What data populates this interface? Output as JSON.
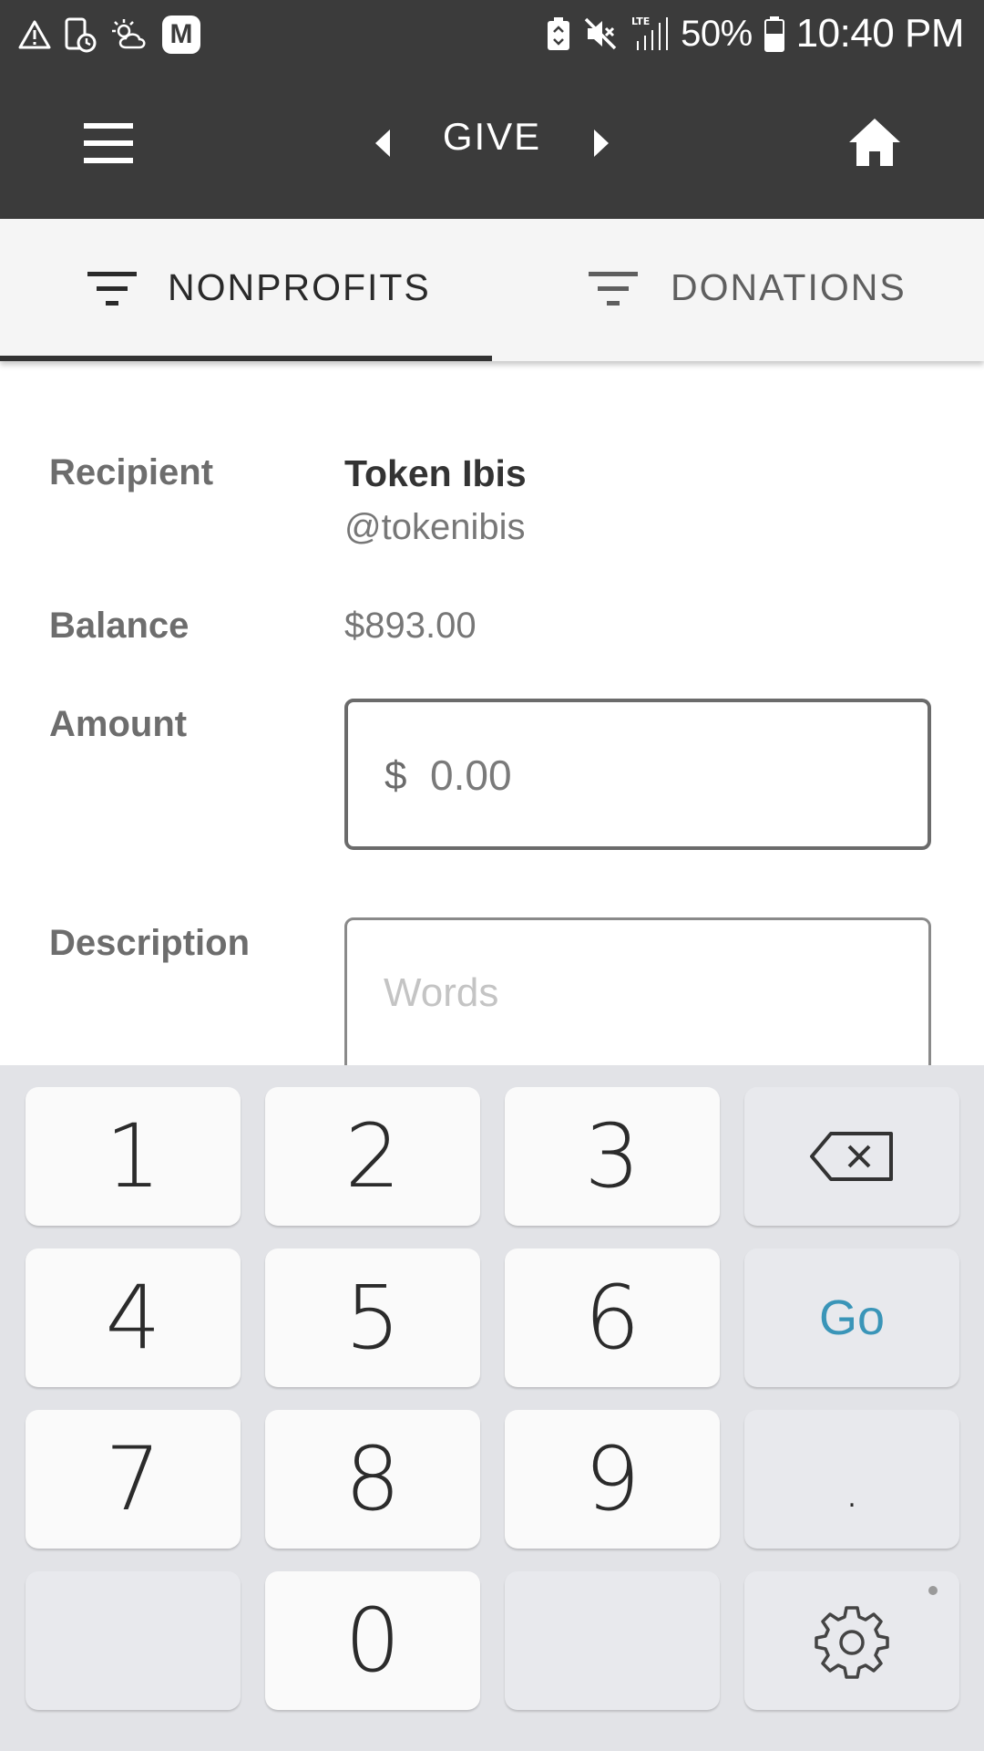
{
  "status_bar": {
    "battery": "50%",
    "time": "10:40 PM",
    "icons": [
      "warning-icon",
      "screen-timer-icon",
      "weather-icon",
      "m-app-icon",
      "battery-saver-icon",
      "mute-icon",
      "lte-signal-icon",
      "battery-icon"
    ],
    "app_badge": "M"
  },
  "app_bar": {
    "title": "GIVE",
    "menu_icon": "hamburger-menu-icon",
    "prev_icon": "chevron-left-icon",
    "next_icon": "chevron-right-icon",
    "home_icon": "home-icon"
  },
  "tabs": [
    {
      "label": "NONPROFITS",
      "icon": "filter-icon",
      "selected": true
    },
    {
      "label": "DONATIONS",
      "icon": "filter-icon",
      "selected": false
    }
  ],
  "form": {
    "recipient_label": "Recipient",
    "recipient_name": "Token Ibis",
    "recipient_handle": "@tokenibis",
    "balance_label": "Balance",
    "balance_value": "$893.00",
    "amount_label": "Amount",
    "amount_currency": "$",
    "amount_placeholder": "0.00",
    "description_label": "Description",
    "description_placeholder": "Words"
  },
  "keyboard": {
    "keys": [
      "1",
      "2",
      "3",
      "4",
      "5",
      "6",
      "7",
      "8",
      "9",
      "0"
    ],
    "go_label": "Go",
    "dot_label": ".",
    "backspace_icon": "backspace-icon",
    "settings_icon": "gear-icon"
  },
  "colors": {
    "bar_background": "#3b3b3b",
    "tab_background": "#f5f5f5",
    "keyboard_background": "#e2e3e7",
    "go_accent": "#3a95b8"
  }
}
